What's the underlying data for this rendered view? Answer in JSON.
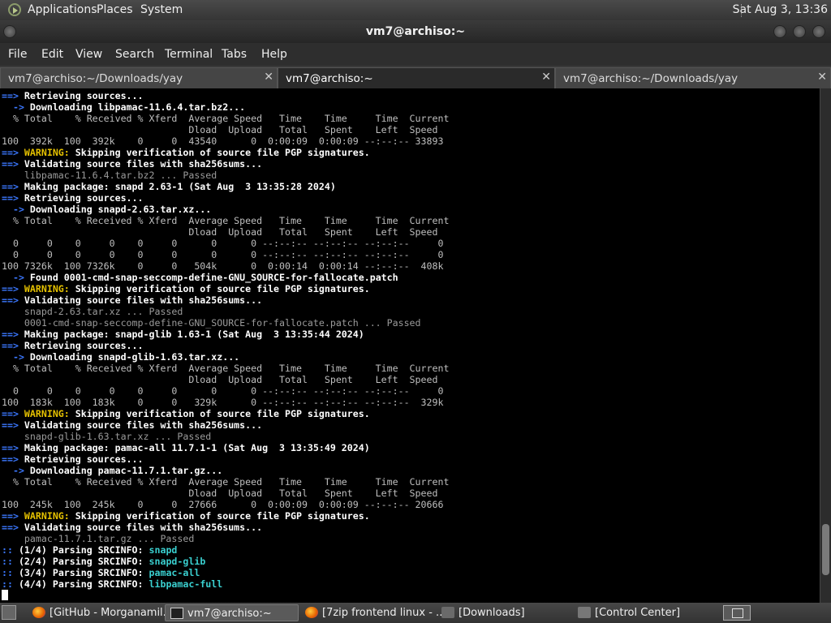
{
  "top_panel": {
    "menus": [
      "Applications",
      "Places",
      "System"
    ],
    "clock": "Sat Aug  3, 13:36"
  },
  "window": {
    "title": "vm7@archiso:~"
  },
  "menubar": {
    "items": [
      "File",
      "Edit",
      "View",
      "Search",
      "Terminal",
      "Tabs",
      "Help"
    ]
  },
  "tabs": [
    {
      "label": "vm7@archiso:~/Downloads/yay",
      "close": "✕"
    },
    {
      "label": "vm7@archiso:~",
      "close": "✕"
    },
    {
      "label": "vm7@archiso:~/Downloads/yay",
      "close": "✕"
    }
  ],
  "terminal": {
    "lines": [
      [
        [
          "a",
          "==> "
        ],
        [
          "w",
          "Retrieving sources..."
        ]
      ],
      [
        [
          "a",
          "  -> "
        ],
        [
          "w",
          "Downloading libpamac-11.6.4.tar.bz2..."
        ]
      ],
      [
        [
          "n",
          "  % Total    % Received % Xferd  Average Speed   Time    Time     Time  Current"
        ]
      ],
      [
        [
          "n",
          "                                 Dload  Upload   Total   Spent    Left  Speed"
        ]
      ],
      [
        [
          "n",
          "100  392k  100  392k    0     0  43540      0  0:00:09  0:00:09 --:--:-- 33893"
        ]
      ],
      [
        [
          "a",
          "==> "
        ],
        [
          "y",
          "WARNING:"
        ],
        [
          "w",
          " Skipping verification of source file PGP signatures."
        ]
      ],
      [
        [
          "a",
          "==> "
        ],
        [
          "w",
          "Validating source files with sha256sums..."
        ]
      ],
      [
        [
          "d",
          "    libpamac-11.6.4.tar.bz2 ... Passed"
        ]
      ],
      [
        [
          "a",
          "==> "
        ],
        [
          "w",
          "Making package: snapd 2.63-1 (Sat Aug  3 13:35:28 2024)"
        ]
      ],
      [
        [
          "a",
          "==> "
        ],
        [
          "w",
          "Retrieving sources..."
        ]
      ],
      [
        [
          "a",
          "  -> "
        ],
        [
          "w",
          "Downloading snapd-2.63.tar.xz..."
        ]
      ],
      [
        [
          "n",
          "  % Total    % Received % Xferd  Average Speed   Time    Time     Time  Current"
        ]
      ],
      [
        [
          "n",
          "                                 Dload  Upload   Total   Spent    Left  Speed"
        ]
      ],
      [
        [
          "n",
          "  0     0    0     0    0     0      0      0 --:--:-- --:--:-- --:--:--     0"
        ]
      ],
      [
        [
          "n",
          "  0     0    0     0    0     0      0      0 --:--:-- --:--:-- --:--:--     0"
        ]
      ],
      [
        [
          "n",
          "100 7326k  100 7326k    0     0   504k      0  0:00:14  0:00:14 --:--:--  408k"
        ]
      ],
      [
        [
          "a",
          "  -> "
        ],
        [
          "w",
          "Found 0001-cmd-snap-seccomp-define-GNU_SOURCE-for-fallocate.patch"
        ]
      ],
      [
        [
          "a",
          "==> "
        ],
        [
          "y",
          "WARNING:"
        ],
        [
          "w",
          " Skipping verification of source file PGP signatures."
        ]
      ],
      [
        [
          "a",
          "==> "
        ],
        [
          "w",
          "Validating source files with sha256sums..."
        ]
      ],
      [
        [
          "d",
          "    snapd-2.63.tar.xz ... Passed"
        ]
      ],
      [
        [
          "d",
          "    0001-cmd-snap-seccomp-define-GNU_SOURCE-for-fallocate.patch ... Passed"
        ]
      ],
      [
        [
          "a",
          "==> "
        ],
        [
          "w",
          "Making package: snapd-glib 1.63-1 (Sat Aug  3 13:35:44 2024)"
        ]
      ],
      [
        [
          "a",
          "==> "
        ],
        [
          "w",
          "Retrieving sources..."
        ]
      ],
      [
        [
          "a",
          "  -> "
        ],
        [
          "w",
          "Downloading snapd-glib-1.63.tar.xz..."
        ]
      ],
      [
        [
          "n",
          "  % Total    % Received % Xferd  Average Speed   Time    Time     Time  Current"
        ]
      ],
      [
        [
          "n",
          "                                 Dload  Upload   Total   Spent    Left  Speed"
        ]
      ],
      [
        [
          "n",
          "  0     0    0     0    0     0      0      0 --:--:-- --:--:-- --:--:--     0"
        ]
      ],
      [
        [
          "n",
          "100  183k  100  183k    0     0   329k      0 --:--:-- --:--:-- --:--:--  329k"
        ]
      ],
      [
        [
          "a",
          "==> "
        ],
        [
          "y",
          "WARNING:"
        ],
        [
          "w",
          " Skipping verification of source file PGP signatures."
        ]
      ],
      [
        [
          "a",
          "==> "
        ],
        [
          "w",
          "Validating source files with sha256sums..."
        ]
      ],
      [
        [
          "d",
          "    snapd-glib-1.63.tar.xz ... Passed"
        ]
      ],
      [
        [
          "a",
          "==> "
        ],
        [
          "w",
          "Making package: pamac-all 11.7.1-1 (Sat Aug  3 13:35:49 2024)"
        ]
      ],
      [
        [
          "a",
          "==> "
        ],
        [
          "w",
          "Retrieving sources..."
        ]
      ],
      [
        [
          "a",
          "  -> "
        ],
        [
          "w",
          "Downloading pamac-11.7.1.tar.gz..."
        ]
      ],
      [
        [
          "n",
          "  % Total    % Received % Xferd  Average Speed   Time    Time     Time  Current"
        ]
      ],
      [
        [
          "n",
          "                                 Dload  Upload   Total   Spent    Left  Speed"
        ]
      ],
      [
        [
          "n",
          "100  245k  100  245k    0     0  27666      0  0:00:09  0:00:09 --:--:-- 20666"
        ]
      ],
      [
        [
          "a",
          "==> "
        ],
        [
          "y",
          "WARNING:"
        ],
        [
          "w",
          " Skipping verification of source file PGP signatures."
        ]
      ],
      [
        [
          "a",
          "==> "
        ],
        [
          "w",
          "Validating source files with sha256sums..."
        ]
      ],
      [
        [
          "d",
          "    pamac-11.7.1.tar.gz ... Passed"
        ]
      ],
      [
        [
          "a",
          ":: "
        ],
        [
          "w",
          "(1/4) Parsing SRCINFO: "
        ],
        [
          "c",
          "snapd"
        ]
      ],
      [
        [
          "a",
          ":: "
        ],
        [
          "w",
          "(2/4) Parsing SRCINFO: "
        ],
        [
          "c",
          "snapd-glib"
        ]
      ],
      [
        [
          "a",
          ":: "
        ],
        [
          "w",
          "(3/4) Parsing SRCINFO: "
        ],
        [
          "c",
          "pamac-all"
        ]
      ],
      [
        [
          "a",
          ":: "
        ],
        [
          "w",
          "(4/4) Parsing SRCINFO: "
        ],
        [
          "c",
          "libpamac-full"
        ]
      ]
    ]
  },
  "taskbar": {
    "items": [
      {
        "label": "[GitHub - Morganamil...",
        "icon": "firefox-icon",
        "active": false
      },
      {
        "label": "vm7@archiso:~",
        "icon": "terminal-icon",
        "active": true
      },
      {
        "label": "[7zip frontend linux - ...",
        "icon": "firefox-icon",
        "active": false
      },
      {
        "label": "[Downloads]",
        "icon": "folder-icon",
        "active": false
      },
      {
        "label": "[Control Center]",
        "icon": "control-center-icon",
        "active": false
      }
    ]
  },
  "scrollbar": {
    "position_fraction": 0.94,
    "thumb_fraction": 0.1
  }
}
